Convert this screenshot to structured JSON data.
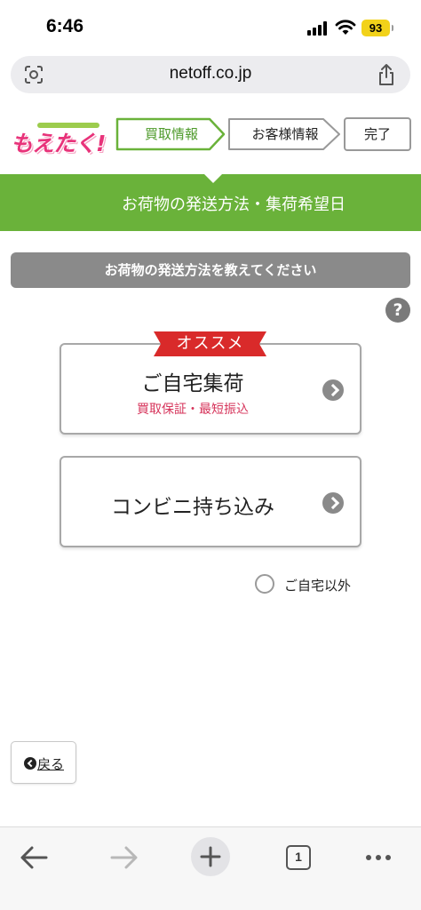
{
  "status_bar": {
    "time": "6:46",
    "battery": "93",
    "icons": [
      "signal-icon",
      "wifi-icon",
      "battery-icon"
    ]
  },
  "browser": {
    "url": "netoff.co.jp",
    "left_icon": "page-scan-icon",
    "right_icon": "share-icon"
  },
  "header": {
    "logo_text": "もえたく!",
    "steps": [
      {
        "label": "買取情報",
        "state": "current"
      },
      {
        "label": "お客様情報",
        "state": "upcoming"
      },
      {
        "label": "完了",
        "state": "upcoming"
      }
    ]
  },
  "title_bar": {
    "title": "お荷物の発送方法・集荷希望日"
  },
  "section": {
    "banner": "お荷物の発送方法を教えてください",
    "help_icon": "?"
  },
  "options": {
    "home_pickup": {
      "ribbon": "オススメ",
      "title": "ご自宅集荷",
      "subtitle": "買取保証・最短振込"
    },
    "convenience_store": {
      "title": "コンビニ持ち込み"
    }
  },
  "radio": {
    "label": "ご自宅以外",
    "checked": false
  },
  "back_button": {
    "label": "戻る"
  },
  "toolbar": {
    "tab_count": "1",
    "icons": [
      "back-arrow-icon",
      "forward-arrow-icon",
      "plus-icon",
      "tabs-icon",
      "more-icon"
    ]
  },
  "colors": {
    "accent_green": "#6ab23a",
    "ribbon_red": "#d92a2a",
    "subtitle_pink": "#d6335a",
    "banner_grey": "#8a8a8a",
    "battery_yellow": "#f2d21a"
  }
}
